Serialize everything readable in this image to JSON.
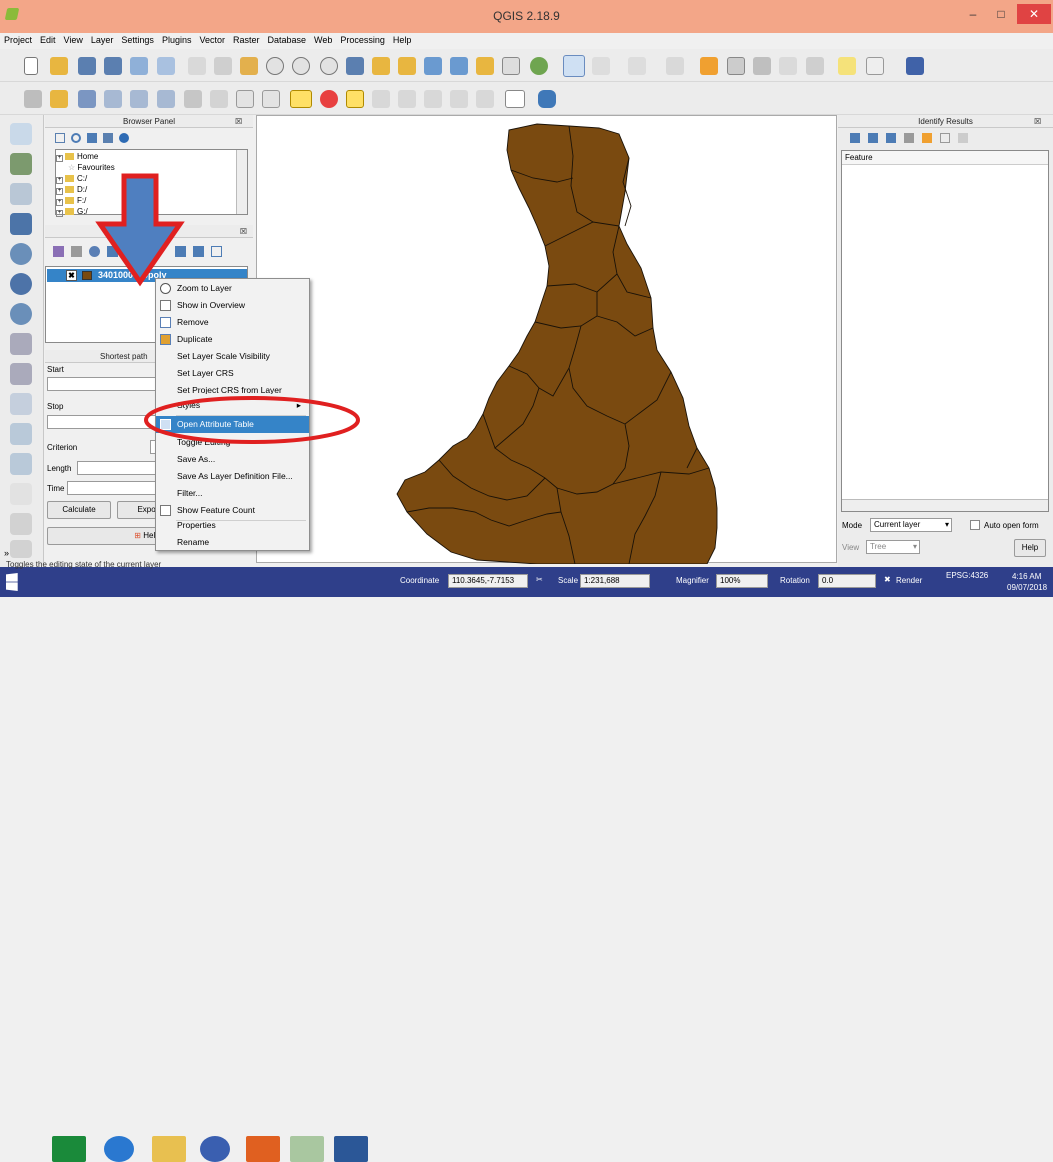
{
  "window": {
    "title": "QGIS 2.18.9",
    "min": "–",
    "max": "□",
    "close": "✕"
  },
  "menubar": [
    "Project",
    "Edit",
    "View",
    "Layer",
    "Settings",
    "Plugins",
    "Vector",
    "Raster",
    "Database",
    "Web",
    "Processing",
    "Help"
  ],
  "browser": {
    "title": "Browser Panel",
    "close_icon": "☒",
    "items": [
      "Home",
      "Favourites",
      "C:/",
      "D:/",
      "F:/",
      "G:/"
    ]
  },
  "layers": {
    "close_icon": "☒",
    "layer_name": "3401000000poly",
    "layer_checkbox": "✖"
  },
  "shortest_path": {
    "title": "Shortest path",
    "start": "Start",
    "stop": "Stop",
    "criterion": "Criterion",
    "length": "Length",
    "time": "Time",
    "calculate": "Calculate",
    "export": "Export",
    "help": "Help"
  },
  "context_menu": {
    "items": [
      "Zoom to Layer",
      "Show in Overview",
      "Remove",
      "Duplicate",
      "Set Layer Scale Visibility",
      "Set Layer CRS",
      "Set Project CRS from Layer",
      "Styles",
      "Open Attribute Table",
      "Toggle Editing",
      "Save As...",
      "Save As Layer Definition File...",
      "Filter...",
      "Show Feature Count",
      "Properties",
      "Rename"
    ],
    "highlighted": "Open Attribute Table",
    "submenu_arrow": "▸"
  },
  "identify": {
    "title": "Identify Results",
    "column": "Feature",
    "mode_label": "Mode",
    "mode_value": "Current layer",
    "auto_open": "Auto open form",
    "view_label": "View",
    "view_value": "Tree",
    "help": "Help"
  },
  "statusbar": {
    "hint": "Toggles the editing state of the current layer",
    "coordinate_label": "Coordinate",
    "coordinate": "110.3645,-7.7153",
    "scale_label": "Scale",
    "scale": "1:231,688",
    "magnifier_label": "Magnifier",
    "magnifier": "100%",
    "rotation_label": "Rotation",
    "rotation": "0.0",
    "render": "Render",
    "crs": "EPSG:4326",
    "time": "4:16 AM",
    "date": "09/07/2018"
  },
  "colors": {
    "polygon": "#7a4a10",
    "titlebar": "#f3a688",
    "highlight": "#3584c8",
    "arrow_fill": "#4f7fc0",
    "arrow_stroke": "#e02020",
    "ellipse": "#e02020"
  }
}
